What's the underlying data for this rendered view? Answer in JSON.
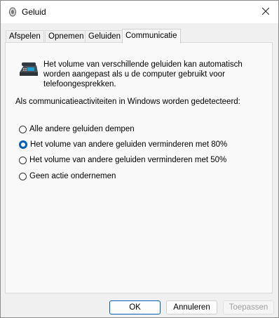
{
  "window": {
    "title": "Geluid",
    "icon": "speaker-icon",
    "close_icon": "close-icon"
  },
  "tabs": [
    {
      "label": "Afspelen",
      "active": false
    },
    {
      "label": "Opnemen",
      "active": false
    },
    {
      "label": "Geluiden",
      "active": false
    },
    {
      "label": "Communicatie",
      "active": true
    }
  ],
  "panel": {
    "description": "Het volume van verschillende geluiden kan automatisch worden aangepast als u de computer gebruikt voor telefoongesprekken.",
    "question": "Als communicatieactiviteiten in Windows worden gedetecteerd:",
    "options": [
      {
        "label": "Alle andere geluiden dempen",
        "checked": false
      },
      {
        "label": "Het volume van andere geluiden verminderen met 80%",
        "checked": true
      },
      {
        "label": "Het volume van andere geluiden verminderen met 50%",
        "checked": false
      },
      {
        "label": "Geen actie ondernemen",
        "checked": false
      }
    ]
  },
  "buttons": {
    "ok": "OK",
    "cancel": "Annuleren",
    "apply": "Toepassen"
  },
  "colors": {
    "accent": "#005fb8",
    "window_bg": "#f0f0f0",
    "panel_bg": "#f9f9f9"
  }
}
